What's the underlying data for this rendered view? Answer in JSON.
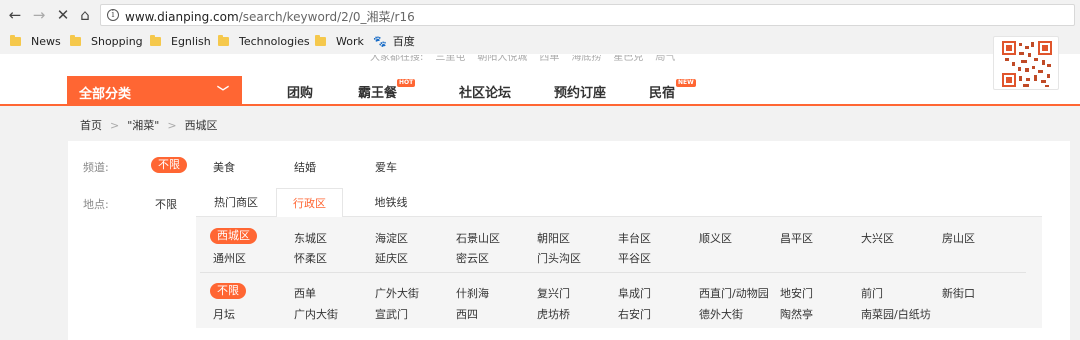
{
  "browser": {
    "url_host": "www.dianping.com",
    "url_path": "/search/keyword/2/0_湘菜/r16",
    "bookmarks": [
      {
        "label": "News",
        "icon": "folder-icon"
      },
      {
        "label": "Shopping",
        "icon": "folder-icon"
      },
      {
        "label": "Egnlish",
        "icon": "folder-icon"
      },
      {
        "label": "Technologies",
        "icon": "folder-icon"
      },
      {
        "label": "Work",
        "icon": "folder-icon"
      },
      {
        "label": "百度",
        "icon": "baidu-paw-icon"
      }
    ]
  },
  "header": {
    "hot_searches": [
      "大家都在搜:",
      "三里屯",
      "朝阳大悦城",
      "西单",
      "海底捞",
      "星巴克",
      "局气"
    ],
    "category_label": "全部分类",
    "nav": [
      {
        "label": "团购",
        "badge": ""
      },
      {
        "label": "霸王餐",
        "badge": "HOT"
      },
      {
        "label": "社区论坛",
        "badge": ""
      },
      {
        "label": "预约订座",
        "badge": ""
      },
      {
        "label": "民宿",
        "badge": "NEW"
      }
    ]
  },
  "breadcrumb": [
    "首页",
    "\"湘菜\"",
    "西城区"
  ],
  "filters": {
    "channel_label": "频道:",
    "channel_options": [
      "不限",
      "美食",
      "结婚",
      "爱车"
    ],
    "location_label": "地点:",
    "location_any": "不限",
    "tabs": [
      "热门商区",
      "行政区",
      "地铁线"
    ],
    "selected_tab": "行政区",
    "districts": [
      "西城区",
      "东城区",
      "海淀区",
      "石景山区",
      "朝阳区",
      "丰台区",
      "顺义区",
      "昌平区",
      "大兴区",
      "房山区",
      "通州区",
      "怀柔区",
      "延庆区",
      "密云区",
      "门头沟区",
      "平谷区"
    ],
    "selected_district": "西城区",
    "subareas": [
      "不限",
      "西单",
      "广外大街",
      "什刹海",
      "复兴门",
      "阜成门",
      "西直门/动物园",
      "地安门",
      "前门",
      "新街口",
      "月坛",
      "广内大街",
      "宣武门",
      "西四",
      "虎坊桥",
      "右安门",
      "德外大街",
      "陶然亭",
      "南菜园/白纸坊"
    ],
    "selected_subarea": "不限"
  },
  "colors": {
    "accent": "#ff6633"
  }
}
